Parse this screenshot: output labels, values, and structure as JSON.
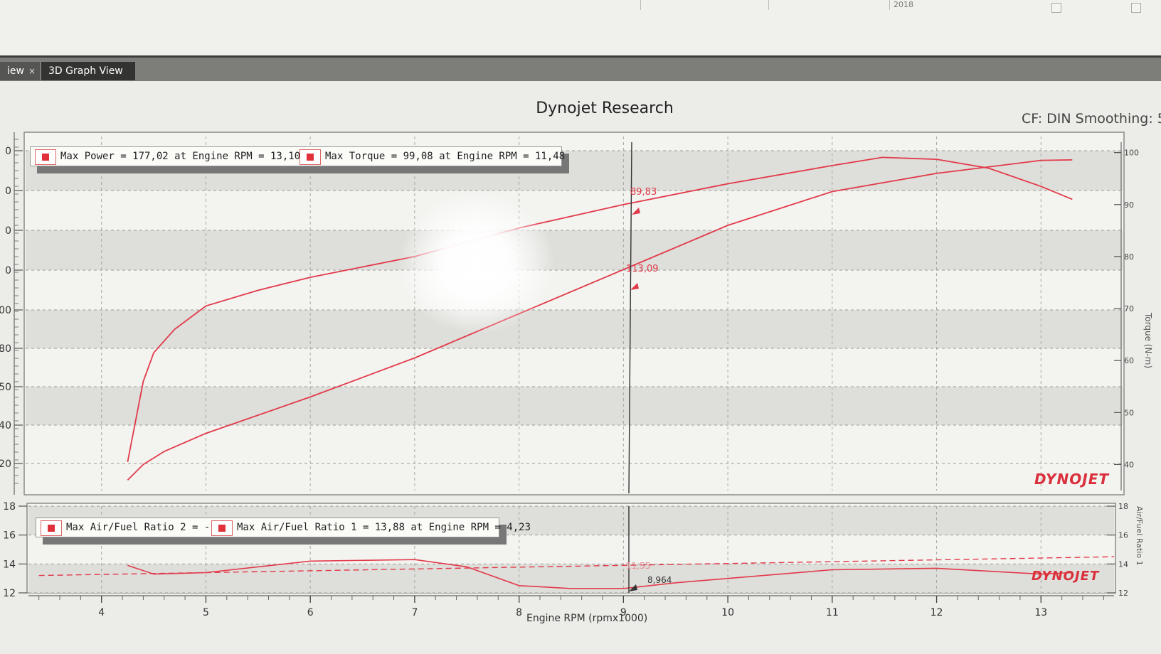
{
  "window": {
    "top_year": "2018",
    "tabs": [
      {
        "label": "iew",
        "close": "×"
      },
      {
        "label": "3D Graph View"
      }
    ]
  },
  "chart_title": "Dynojet Research",
  "cf_label": "CF: DIN Smoothing: 5",
  "brand_logo": "DYNOJET",
  "colors": {
    "trace": "#e23a4a",
    "background": "#ecece8",
    "band": "#dededa",
    "logo": "#d9303c"
  },
  "chart_data": [
    {
      "type": "line",
      "panel": "power-torque",
      "legend": {
        "max_power": "Max Power = 177,02 at Engine RPM = 13,10",
        "max_torque": "Max Torque = 99,08 at Engine RPM = 11,48"
      },
      "xlim": [
        3.3,
        13.7
      ],
      "y_left_ticks": [
        "0",
        "0",
        "0",
        "0",
        "00",
        "80",
        "50",
        "40",
        "20"
      ],
      "y_right_ticks": [
        "100",
        "90",
        "80",
        "70",
        "60",
        "50",
        "40"
      ],
      "y_right_label": "Torque (N-m)",
      "ylim_right": [
        35,
        102
      ],
      "cursor_rpm": 9.0,
      "cursor_values": {
        "torque": "89,83",
        "power": "113,09"
      },
      "series": [
        {
          "name": "Torque",
          "x": [
            4.25,
            4.4,
            4.5,
            4.7,
            5.0,
            5.5,
            6.0,
            7.0,
            8.0,
            9.0,
            10.0,
            11.0,
            11.48,
            12.0,
            12.5,
            13.0,
            13.3
          ],
          "y": [
            40.5,
            56.0,
            61.5,
            66.0,
            70.5,
            73.5,
            76.0,
            80.0,
            85.5,
            90.0,
            94.0,
            97.5,
            99.08,
            98.7,
            97.0,
            93.5,
            91.0
          ]
        },
        {
          "name": "Power",
          "x": [
            4.25,
            4.4,
            4.6,
            5.0,
            6.0,
            7.0,
            8.0,
            9.0,
            10.0,
            11.0,
            12.0,
            13.0,
            13.3
          ],
          "y": [
            37.0,
            40.0,
            42.5,
            46.0,
            53.0,
            60.5,
            69.0,
            77.5,
            86.0,
            92.5,
            96.0,
            98.5,
            98.6
          ]
        }
      ]
    },
    {
      "type": "line",
      "panel": "air-fuel",
      "legend": {
        "afr2": "Max Air/Fuel Ratio 2 = ---",
        "afr1": "Max Air/Fuel Ratio 1 = 13,88 at Engine RPM = 4,23"
      },
      "x_ticks": [
        "4",
        "5",
        "6",
        "7",
        "8",
        "9",
        "10",
        "11",
        "12",
        "13"
      ],
      "xlabel": "Engine RPM (rpmx1000)",
      "xlim": [
        3.3,
        13.7
      ],
      "y_left_ticks": [
        "18",
        "16",
        "14",
        "12"
      ],
      "y_right_ticks": [
        "18",
        "16",
        "14",
        "12"
      ],
      "y_right_label": "Air/Fuel Ratio 1",
      "ylim": [
        12,
        18
      ],
      "cursor_rpm": 9.0,
      "cursor_values": {
        "upper": "11,55",
        "lower": "8,964"
      },
      "series": [
        {
          "name": "Air/Fuel Ratio 1",
          "x": [
            4.25,
            4.5,
            5.0,
            6.0,
            7.0,
            7.5,
            8.0,
            8.5,
            9.0,
            9.5,
            10.0,
            11.0,
            12.0,
            13.0,
            13.3
          ],
          "y": [
            13.9,
            13.3,
            13.4,
            14.2,
            14.3,
            13.8,
            12.5,
            12.3,
            12.3,
            12.7,
            13.0,
            13.6,
            13.7,
            13.3,
            13.4
          ]
        },
        {
          "name": "reference",
          "x": [
            3.4,
            13.7
          ],
          "y": [
            13.2,
            14.5
          ]
        }
      ]
    }
  ]
}
